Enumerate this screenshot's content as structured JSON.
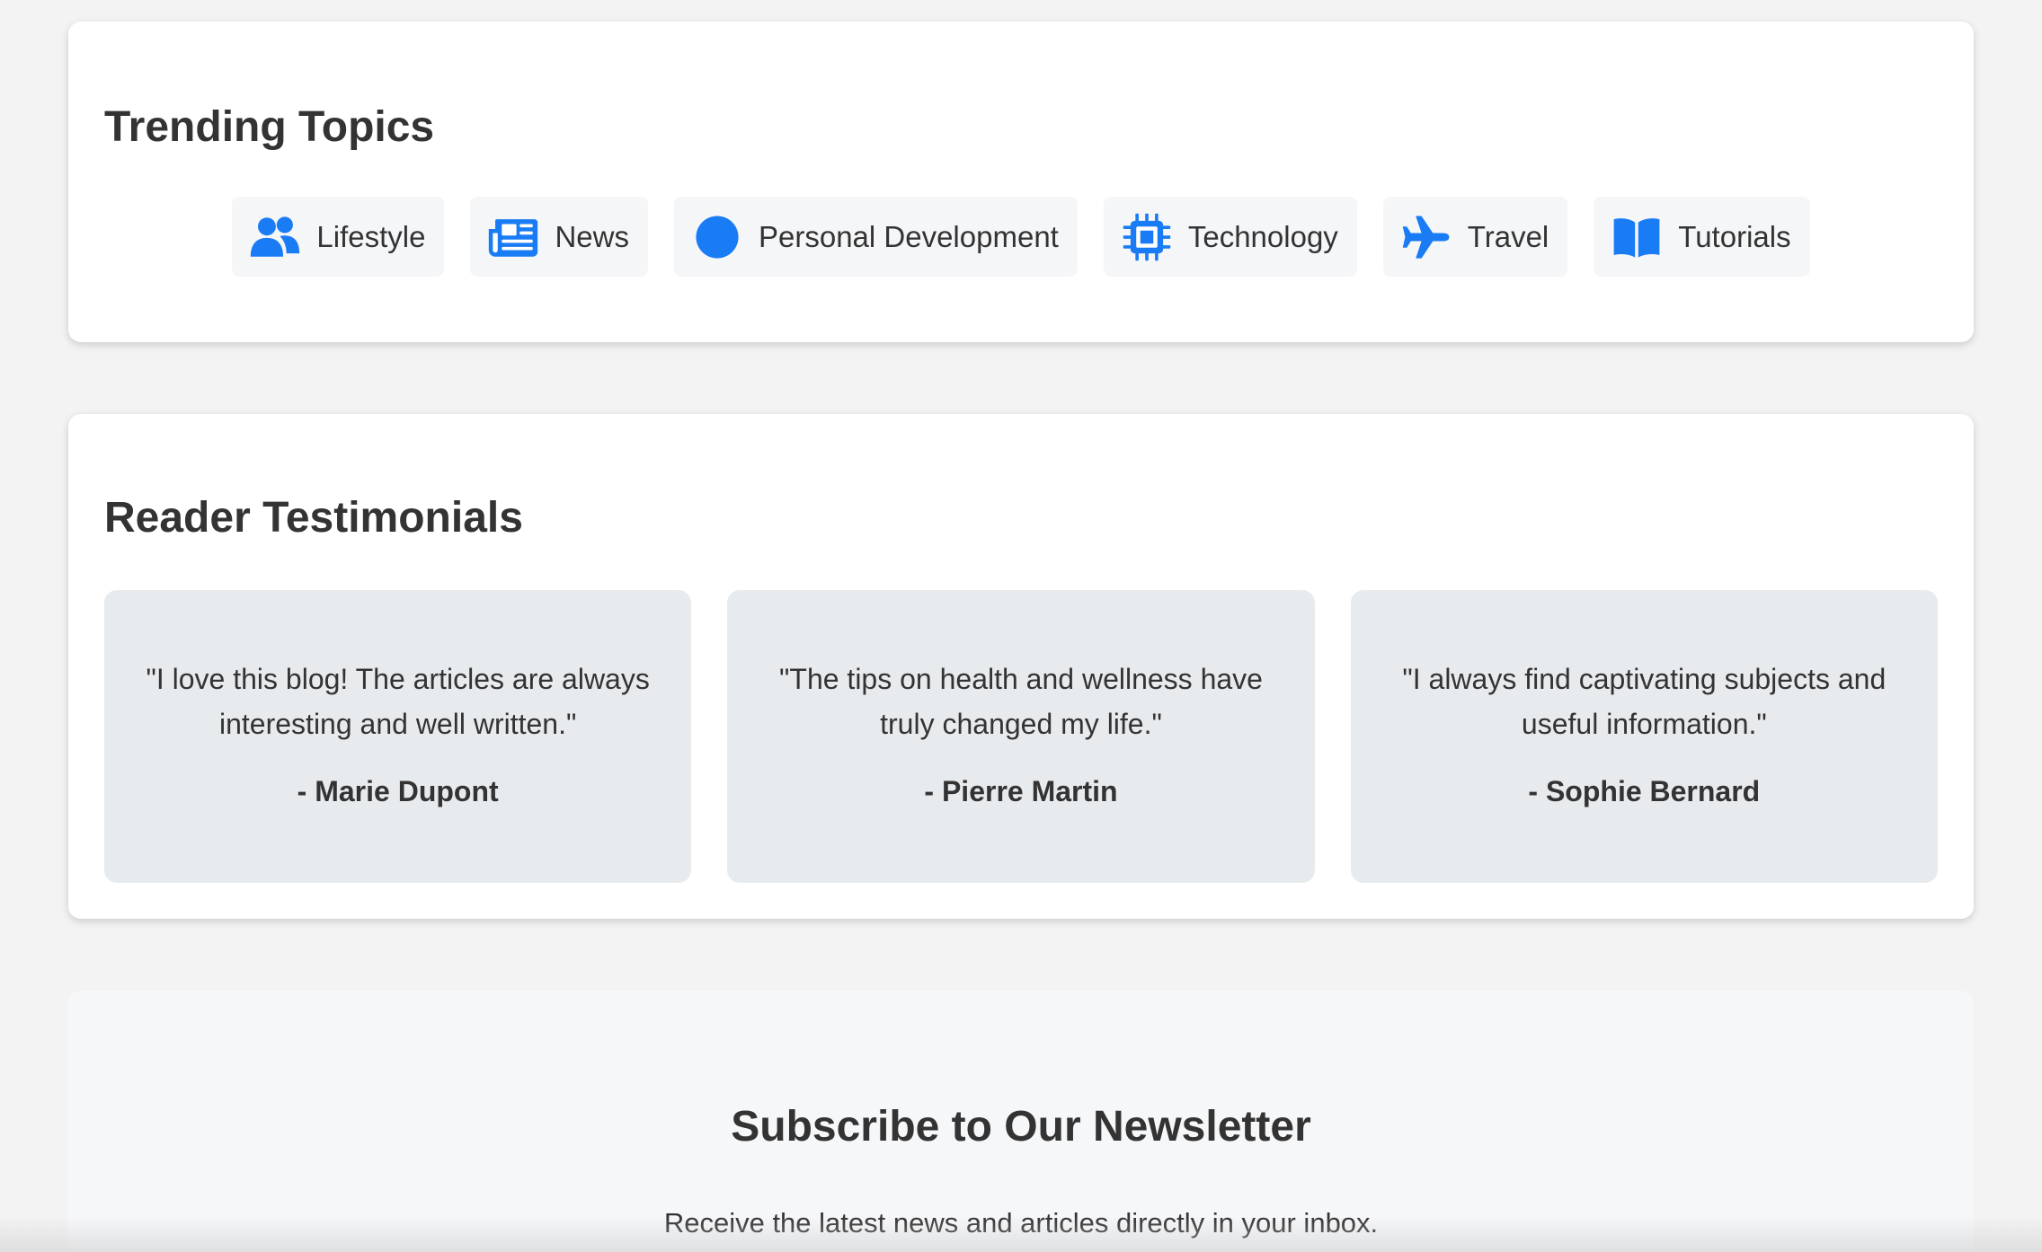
{
  "colors": {
    "accent": "#1a7cf5",
    "text": "#333333",
    "page_background": "#f3f3f3",
    "card_background": "#ffffff",
    "chip_background": "#f5f6f8",
    "testimonial_background": "#e8ebee"
  },
  "trending": {
    "title": "Trending Topics",
    "topics": [
      {
        "label": "Lifestyle",
        "icon": "users-icon"
      },
      {
        "label": "News",
        "icon": "newspaper-icon"
      },
      {
        "label": "Personal Development",
        "icon": "circle-icon"
      },
      {
        "label": "Technology",
        "icon": "microchip-icon"
      },
      {
        "label": "Travel",
        "icon": "plane-icon"
      },
      {
        "label": "Tutorials",
        "icon": "book-open-icon"
      }
    ]
  },
  "testimonials": {
    "title": "Reader Testimonials",
    "items": [
      {
        "quote": "\"I love this blog! The articles are always interesting and well written.\"",
        "author": "- Marie Dupont"
      },
      {
        "quote": "\"The tips on health and wellness have truly changed my life.\"",
        "author": "- Pierre Martin"
      },
      {
        "quote": "\"I always find captivating subjects and useful information.\"",
        "author": "- Sophie Bernard"
      }
    ]
  },
  "newsletter": {
    "title": "Subscribe to Our Newsletter",
    "text": "Receive the latest news and articles directly in your inbox."
  }
}
